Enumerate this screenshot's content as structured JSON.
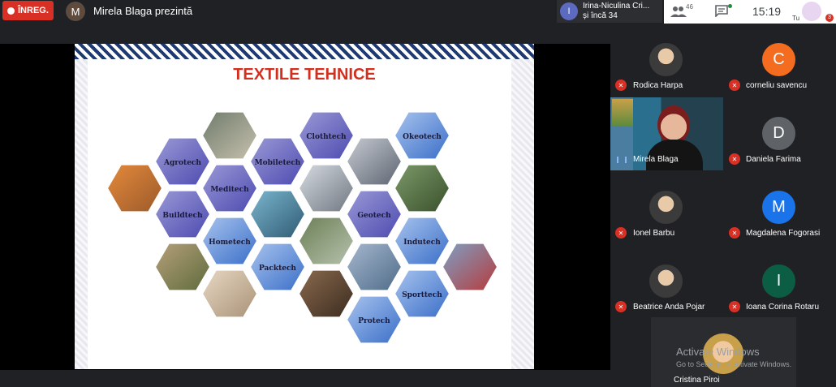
{
  "topbar": {
    "rec_label": "ÎNREG.",
    "presenter_initial": "M",
    "presenter_text": "Mirela Blaga prezintă",
    "people_initial": "I",
    "people_line1": "Irina-Niculina Cri...",
    "people_line2": "și încă 34",
    "participant_count": "46",
    "time": "15:19",
    "self_label": "Tu",
    "self_badge": "3"
  },
  "slide": {
    "title": "TEXTILE TEHNICE",
    "hexagons": [
      "Agrotech",
      "Meditech",
      "Buildtech",
      "Mobiletech",
      "Clothtech",
      "Okeotech",
      "Geotech",
      "Hometech",
      "Indutech",
      "Packtech",
      "Sporttech",
      "Protech"
    ]
  },
  "participants": [
    {
      "name": "Rodica Harpa",
      "initial": "",
      "color": "#3b3b3b"
    },
    {
      "name": "corneliu savencu",
      "initial": "C",
      "color": "#f36c1f"
    },
    {
      "name": "Mirela Blaga",
      "initial": "",
      "color": "#24414f"
    },
    {
      "name": "Daniela Farima",
      "initial": "D",
      "color": "#5f6368"
    },
    {
      "name": "Ionel Barbu",
      "initial": "",
      "color": "#2b5e8c"
    },
    {
      "name": "Magdalena Fogorasi",
      "initial": "M",
      "color": "#1a73e8"
    },
    {
      "name": "Beatrice Anda Pojar",
      "initial": "",
      "color": "#3b3b3b"
    },
    {
      "name": "Ioana Corina Rotaru",
      "initial": "I",
      "color": "#0b5e43"
    },
    {
      "name": "Cristina Piroi",
      "initial": "",
      "color": "#c9a04a"
    }
  ],
  "watermark": {
    "line1": "Activate Windows",
    "line2": "Go to Settings to activate Windows."
  }
}
